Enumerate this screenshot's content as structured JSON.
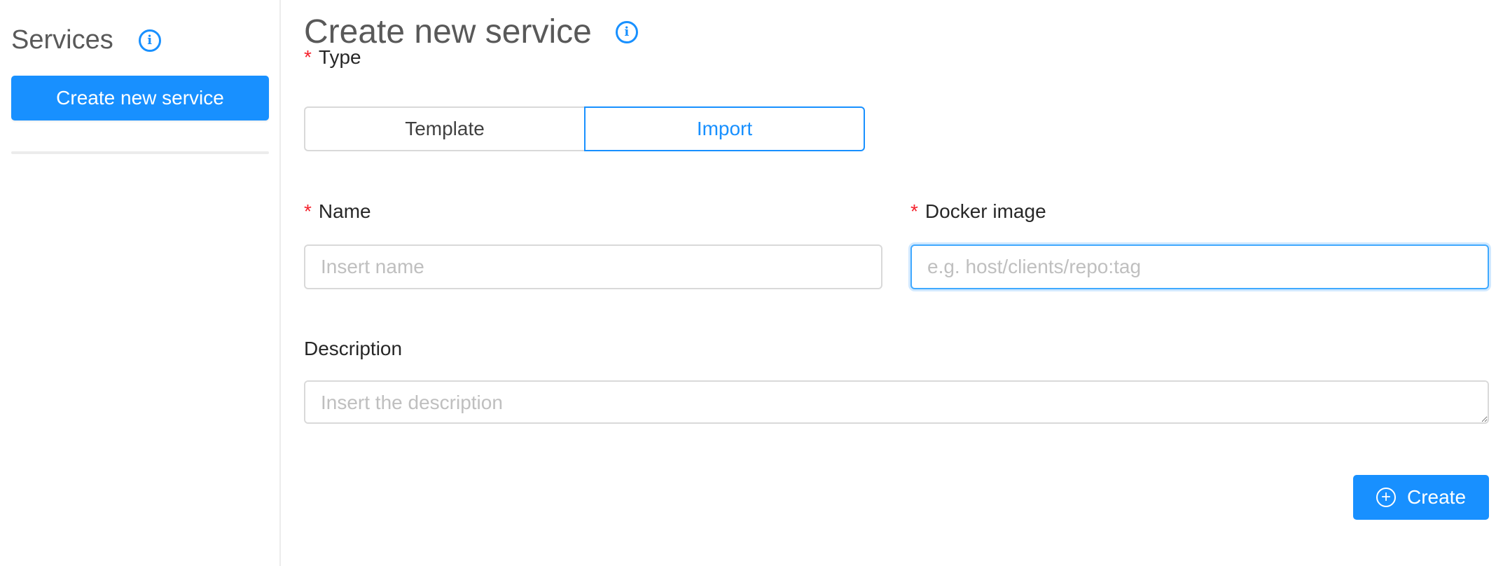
{
  "sidebar": {
    "title": "Services",
    "info_icon": "info-circle-icon",
    "create_button_label": "Create new service"
  },
  "main": {
    "title": "Create new service",
    "info_icon": "info-circle-icon",
    "type": {
      "label": "Type",
      "required": true,
      "options": [
        "Template",
        "Import"
      ],
      "selected": "Import"
    },
    "name": {
      "label": "Name",
      "required": true,
      "value": "",
      "placeholder": "Insert name"
    },
    "docker_image": {
      "label": "Docker image",
      "required": true,
      "value": "",
      "placeholder": "e.g. host/clients/repo:tag",
      "focused": true
    },
    "description": {
      "label": "Description",
      "value": "",
      "placeholder": "Insert the description"
    },
    "submit": {
      "label": "Create",
      "icon": "plus-circle-icon"
    }
  },
  "colors": {
    "primary": "#1890ff",
    "required": "#f5222d",
    "border": "#d9d9d9"
  }
}
